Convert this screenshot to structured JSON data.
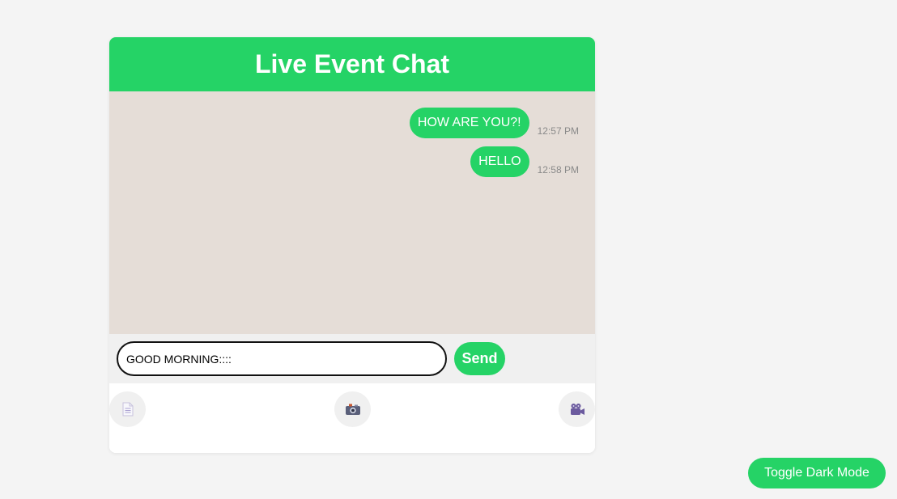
{
  "header": {
    "title": "Live Event Chat"
  },
  "messages": [
    {
      "text": "HOW ARE YOU?!",
      "time": "12:57 PM"
    },
    {
      "text": "HELLO",
      "time": "12:58 PM"
    }
  ],
  "composer": {
    "value": "GOOD MORNING::::",
    "send_label": "Send"
  },
  "attachments": [
    {
      "icon": "document-icon"
    },
    {
      "icon": "camera-icon"
    },
    {
      "icon": "video-camera-icon"
    }
  ],
  "toggle_dark_label": "Toggle Dark Mode",
  "colors": {
    "accent": "#25d366",
    "chat_background": "#e5ddd7",
    "page_background": "#f4f4f4"
  }
}
